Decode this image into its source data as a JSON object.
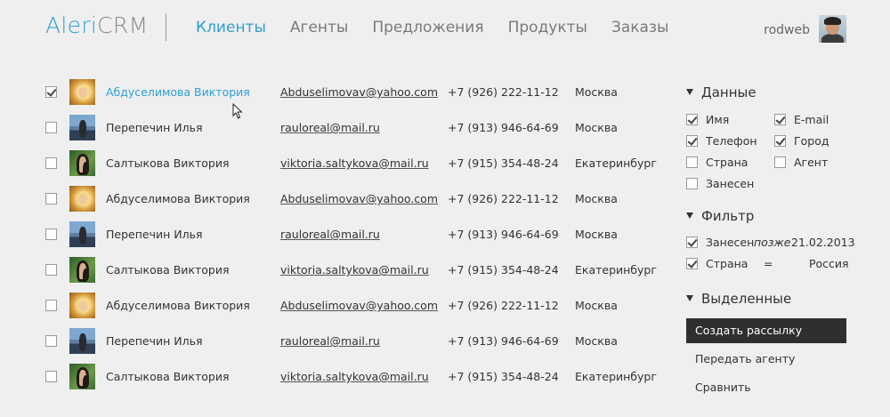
{
  "header": {
    "logo_part1": "Aleri",
    "logo_part2": "CRM",
    "nav": [
      "Клиенты",
      "Агенты",
      "Предложения",
      "Продукты",
      "Заказы"
    ],
    "active_nav": 0,
    "username": "rodweb"
  },
  "clients": [
    {
      "name": "Абдуселимова Виктория",
      "email": "Abduselimovav@yahoo.com",
      "phone": "+7 (926) 222-11-12",
      "city": "Москва",
      "checked": true,
      "hovered": true,
      "photo": "blonde"
    },
    {
      "name": "Перепечин Илья",
      "email": "rauloreal@mail.ru",
      "phone": "+7 (913) 946-64-69",
      "city": "Москва",
      "checked": false,
      "hovered": false,
      "photo": "sea"
    },
    {
      "name": "Салтыкова Виктория",
      "email": "viktoria.saltykova@mail.ru",
      "phone": "+7 (915) 354-48-24",
      "city": "Екатеринбург",
      "checked": false,
      "hovered": false,
      "photo": "dark"
    },
    {
      "name": "Абдуселимова Виктория",
      "email": "Abduselimovav@yahoo.com",
      "phone": "+7 (926) 222-11-12",
      "city": "Москва",
      "checked": false,
      "hovered": false,
      "photo": "blonde"
    },
    {
      "name": "Перепечин Илья",
      "email": "rauloreal@mail.ru",
      "phone": "+7 (913) 946-64-69",
      "city": "Москва",
      "checked": false,
      "hovered": false,
      "photo": "sea"
    },
    {
      "name": "Салтыкова Виктория",
      "email": "viktoria.saltykova@mail.ru",
      "phone": "+7 (915) 354-48-24",
      "city": "Екатеринбург",
      "checked": false,
      "hovered": false,
      "photo": "dark"
    },
    {
      "name": "Абдуселимова Виктория",
      "email": "Abduselimovav@yahoo.com",
      "phone": "+7 (926) 222-11-12",
      "city": "Москва",
      "checked": false,
      "hovered": false,
      "photo": "blonde"
    },
    {
      "name": "Перепечин Илья",
      "email": "rauloreal@mail.ru",
      "phone": "+7 (913) 946-64-69",
      "city": "Москва",
      "checked": false,
      "hovered": false,
      "photo": "sea"
    },
    {
      "name": "Салтыкова Виктория",
      "email": "viktoria.saltykova@mail.ru",
      "phone": "+7 (915) 354-48-24",
      "city": "Екатеринбург",
      "checked": false,
      "hovered": false,
      "photo": "dark"
    }
  ],
  "panel": {
    "data_title": "Данные",
    "columns": [
      {
        "label": "Имя",
        "checked": true
      },
      {
        "label": "E-mail",
        "checked": true
      },
      {
        "label": "Телефон",
        "checked": true
      },
      {
        "label": "Город",
        "checked": true
      },
      {
        "label": "Страна",
        "checked": false
      },
      {
        "label": "Агент",
        "checked": false
      },
      {
        "label": "Занесен",
        "checked": false
      }
    ],
    "filter_title": "Фильтр",
    "filters": [
      {
        "field": "Занесен",
        "op": "позже",
        "value": "21.02.2013",
        "checked": true
      },
      {
        "field": "Страна",
        "op": "=",
        "value": "Россия",
        "checked": true
      }
    ],
    "selected_title": "Выделенные",
    "actions": [
      "Создать рассылку",
      "Передать агенту",
      "Сравнить"
    ]
  },
  "colors": {
    "accent": "#2e9fd6",
    "background": "#efefef",
    "primary_button": "#2f2f2f"
  }
}
